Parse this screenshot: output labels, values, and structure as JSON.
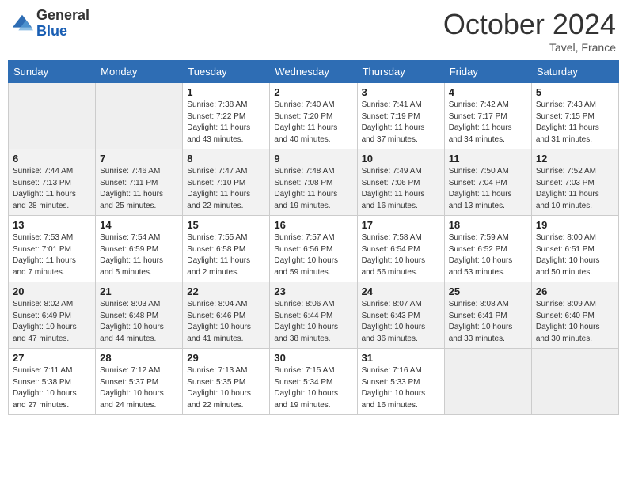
{
  "header": {
    "logo_line1": "General",
    "logo_line2": "Blue",
    "month": "October 2024",
    "location": "Tavel, France"
  },
  "weekdays": [
    "Sunday",
    "Monday",
    "Tuesday",
    "Wednesday",
    "Thursday",
    "Friday",
    "Saturday"
  ],
  "weeks": [
    [
      {
        "day": "",
        "empty": true
      },
      {
        "day": "",
        "empty": true
      },
      {
        "day": "1",
        "sunrise": "Sunrise: 7:38 AM",
        "sunset": "Sunset: 7:22 PM",
        "daylight": "Daylight: 11 hours and 43 minutes."
      },
      {
        "day": "2",
        "sunrise": "Sunrise: 7:40 AM",
        "sunset": "Sunset: 7:20 PM",
        "daylight": "Daylight: 11 hours and 40 minutes."
      },
      {
        "day": "3",
        "sunrise": "Sunrise: 7:41 AM",
        "sunset": "Sunset: 7:19 PM",
        "daylight": "Daylight: 11 hours and 37 minutes."
      },
      {
        "day": "4",
        "sunrise": "Sunrise: 7:42 AM",
        "sunset": "Sunset: 7:17 PM",
        "daylight": "Daylight: 11 hours and 34 minutes."
      },
      {
        "day": "5",
        "sunrise": "Sunrise: 7:43 AM",
        "sunset": "Sunset: 7:15 PM",
        "daylight": "Daylight: 11 hours and 31 minutes."
      }
    ],
    [
      {
        "day": "6",
        "sunrise": "Sunrise: 7:44 AM",
        "sunset": "Sunset: 7:13 PM",
        "daylight": "Daylight: 11 hours and 28 minutes."
      },
      {
        "day": "7",
        "sunrise": "Sunrise: 7:46 AM",
        "sunset": "Sunset: 7:11 PM",
        "daylight": "Daylight: 11 hours and 25 minutes."
      },
      {
        "day": "8",
        "sunrise": "Sunrise: 7:47 AM",
        "sunset": "Sunset: 7:10 PM",
        "daylight": "Daylight: 11 hours and 22 minutes."
      },
      {
        "day": "9",
        "sunrise": "Sunrise: 7:48 AM",
        "sunset": "Sunset: 7:08 PM",
        "daylight": "Daylight: 11 hours and 19 minutes."
      },
      {
        "day": "10",
        "sunrise": "Sunrise: 7:49 AM",
        "sunset": "Sunset: 7:06 PM",
        "daylight": "Daylight: 11 hours and 16 minutes."
      },
      {
        "day": "11",
        "sunrise": "Sunrise: 7:50 AM",
        "sunset": "Sunset: 7:04 PM",
        "daylight": "Daylight: 11 hours and 13 minutes."
      },
      {
        "day": "12",
        "sunrise": "Sunrise: 7:52 AM",
        "sunset": "Sunset: 7:03 PM",
        "daylight": "Daylight: 11 hours and 10 minutes."
      }
    ],
    [
      {
        "day": "13",
        "sunrise": "Sunrise: 7:53 AM",
        "sunset": "Sunset: 7:01 PM",
        "daylight": "Daylight: 11 hours and 7 minutes."
      },
      {
        "day": "14",
        "sunrise": "Sunrise: 7:54 AM",
        "sunset": "Sunset: 6:59 PM",
        "daylight": "Daylight: 11 hours and 5 minutes."
      },
      {
        "day": "15",
        "sunrise": "Sunrise: 7:55 AM",
        "sunset": "Sunset: 6:58 PM",
        "daylight": "Daylight: 11 hours and 2 minutes."
      },
      {
        "day": "16",
        "sunrise": "Sunrise: 7:57 AM",
        "sunset": "Sunset: 6:56 PM",
        "daylight": "Daylight: 10 hours and 59 minutes."
      },
      {
        "day": "17",
        "sunrise": "Sunrise: 7:58 AM",
        "sunset": "Sunset: 6:54 PM",
        "daylight": "Daylight: 10 hours and 56 minutes."
      },
      {
        "day": "18",
        "sunrise": "Sunrise: 7:59 AM",
        "sunset": "Sunset: 6:52 PM",
        "daylight": "Daylight: 10 hours and 53 minutes."
      },
      {
        "day": "19",
        "sunrise": "Sunrise: 8:00 AM",
        "sunset": "Sunset: 6:51 PM",
        "daylight": "Daylight: 10 hours and 50 minutes."
      }
    ],
    [
      {
        "day": "20",
        "sunrise": "Sunrise: 8:02 AM",
        "sunset": "Sunset: 6:49 PM",
        "daylight": "Daylight: 10 hours and 47 minutes."
      },
      {
        "day": "21",
        "sunrise": "Sunrise: 8:03 AM",
        "sunset": "Sunset: 6:48 PM",
        "daylight": "Daylight: 10 hours and 44 minutes."
      },
      {
        "day": "22",
        "sunrise": "Sunrise: 8:04 AM",
        "sunset": "Sunset: 6:46 PM",
        "daylight": "Daylight: 10 hours and 41 minutes."
      },
      {
        "day": "23",
        "sunrise": "Sunrise: 8:06 AM",
        "sunset": "Sunset: 6:44 PM",
        "daylight": "Daylight: 10 hours and 38 minutes."
      },
      {
        "day": "24",
        "sunrise": "Sunrise: 8:07 AM",
        "sunset": "Sunset: 6:43 PM",
        "daylight": "Daylight: 10 hours and 36 minutes."
      },
      {
        "day": "25",
        "sunrise": "Sunrise: 8:08 AM",
        "sunset": "Sunset: 6:41 PM",
        "daylight": "Daylight: 10 hours and 33 minutes."
      },
      {
        "day": "26",
        "sunrise": "Sunrise: 8:09 AM",
        "sunset": "Sunset: 6:40 PM",
        "daylight": "Daylight: 10 hours and 30 minutes."
      }
    ],
    [
      {
        "day": "27",
        "sunrise": "Sunrise: 7:11 AM",
        "sunset": "Sunset: 5:38 PM",
        "daylight": "Daylight: 10 hours and 27 minutes."
      },
      {
        "day": "28",
        "sunrise": "Sunrise: 7:12 AM",
        "sunset": "Sunset: 5:37 PM",
        "daylight": "Daylight: 10 hours and 24 minutes."
      },
      {
        "day": "29",
        "sunrise": "Sunrise: 7:13 AM",
        "sunset": "Sunset: 5:35 PM",
        "daylight": "Daylight: 10 hours and 22 minutes."
      },
      {
        "day": "30",
        "sunrise": "Sunrise: 7:15 AM",
        "sunset": "Sunset: 5:34 PM",
        "daylight": "Daylight: 10 hours and 19 minutes."
      },
      {
        "day": "31",
        "sunrise": "Sunrise: 7:16 AM",
        "sunset": "Sunset: 5:33 PM",
        "daylight": "Daylight: 10 hours and 16 minutes."
      },
      {
        "day": "",
        "empty": true
      },
      {
        "day": "",
        "empty": true
      }
    ]
  ]
}
